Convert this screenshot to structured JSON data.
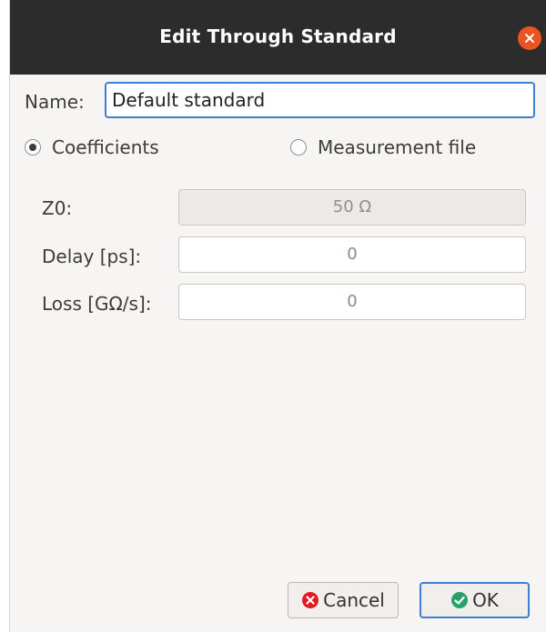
{
  "dialog": {
    "title": "Edit Through Standard"
  },
  "name": {
    "label": "Name:",
    "value": "Default standard"
  },
  "mode": {
    "options": [
      "Coefficients",
      "Measurement file"
    ],
    "selected": "Coefficients"
  },
  "fields": [
    {
      "label": "Z0:",
      "value": "50 Ω",
      "enabled": false
    },
    {
      "label": "Delay [ps]:",
      "value": "0",
      "enabled": true
    },
    {
      "label": "Loss [GΩ/s]:",
      "value": "0",
      "enabled": true
    }
  ],
  "buttons": {
    "cancel": {
      "label": "Cancel",
      "icon": "cancel-icon",
      "color": "#e01b24"
    },
    "ok": {
      "label": "OK",
      "icon": "check-icon",
      "color": "#26a269"
    }
  },
  "colors": {
    "titlebar": "#2c2c2c",
    "close": "#e95420",
    "focus": "#3d7ed7"
  }
}
